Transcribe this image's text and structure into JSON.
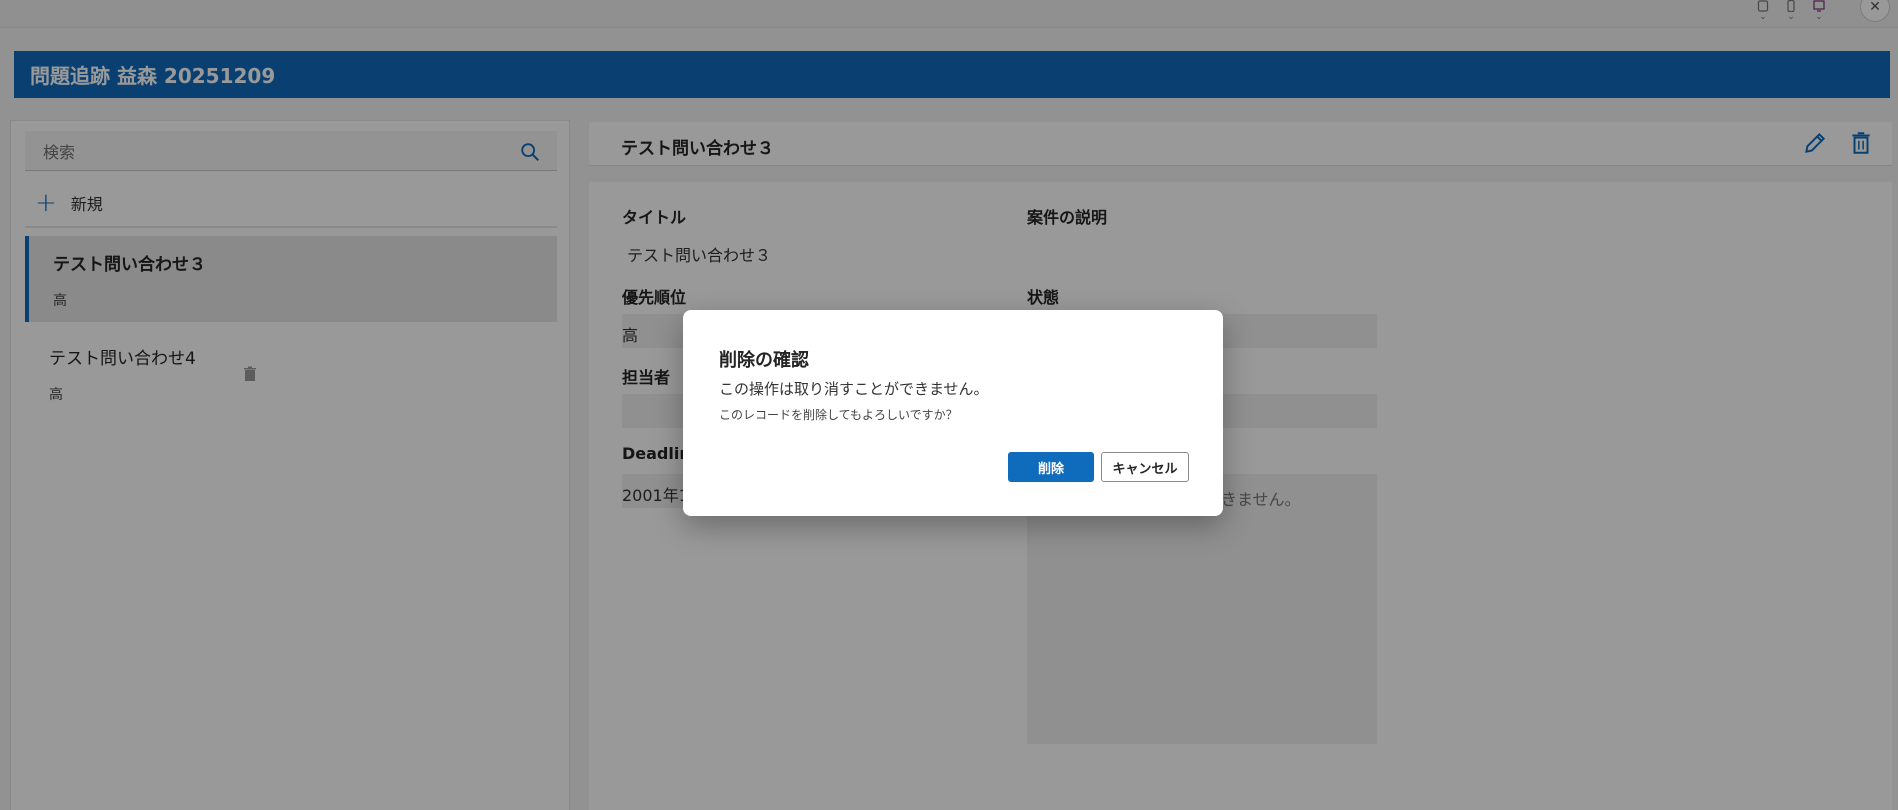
{
  "app": {
    "title": "問題追跡 益森 20251209"
  },
  "search": {
    "placeholder": "検索"
  },
  "new_label": "新規",
  "list": [
    {
      "title": "テスト問い合わせ３",
      "priority": "高"
    },
    {
      "title": "テスト問い合わせ4",
      "priority": "高"
    }
  ],
  "detail": {
    "header_title": "テスト問い合わせ３",
    "labels": {
      "title": "タイトル",
      "description": "案件の説明",
      "priority": "優先順位",
      "status": "状態",
      "assignee": "担当者",
      "deadline": "Deadline"
    },
    "values": {
      "title": "テスト問い合わせ３",
      "priority": "高",
      "deadline": "2001年1",
      "description_partial": "きません。"
    }
  },
  "dialog": {
    "title": "削除の確認",
    "message": "この操作は取り消すことができません。",
    "question": "このレコードを削除してもよろしいですか？",
    "confirm_label": "削除",
    "cancel_label": "キャンセル"
  },
  "icons": {
    "top": [
      "tablet-icon",
      "phone-icon",
      "monitor-icon"
    ],
    "close": "close-icon",
    "search": "search-icon",
    "add": "plus-icon",
    "edit": "pencil-icon",
    "delete": "trash-icon"
  },
  "colors": {
    "accent": "#0f6cbd",
    "overlay": "rgba(0,0,0,0.40)"
  }
}
